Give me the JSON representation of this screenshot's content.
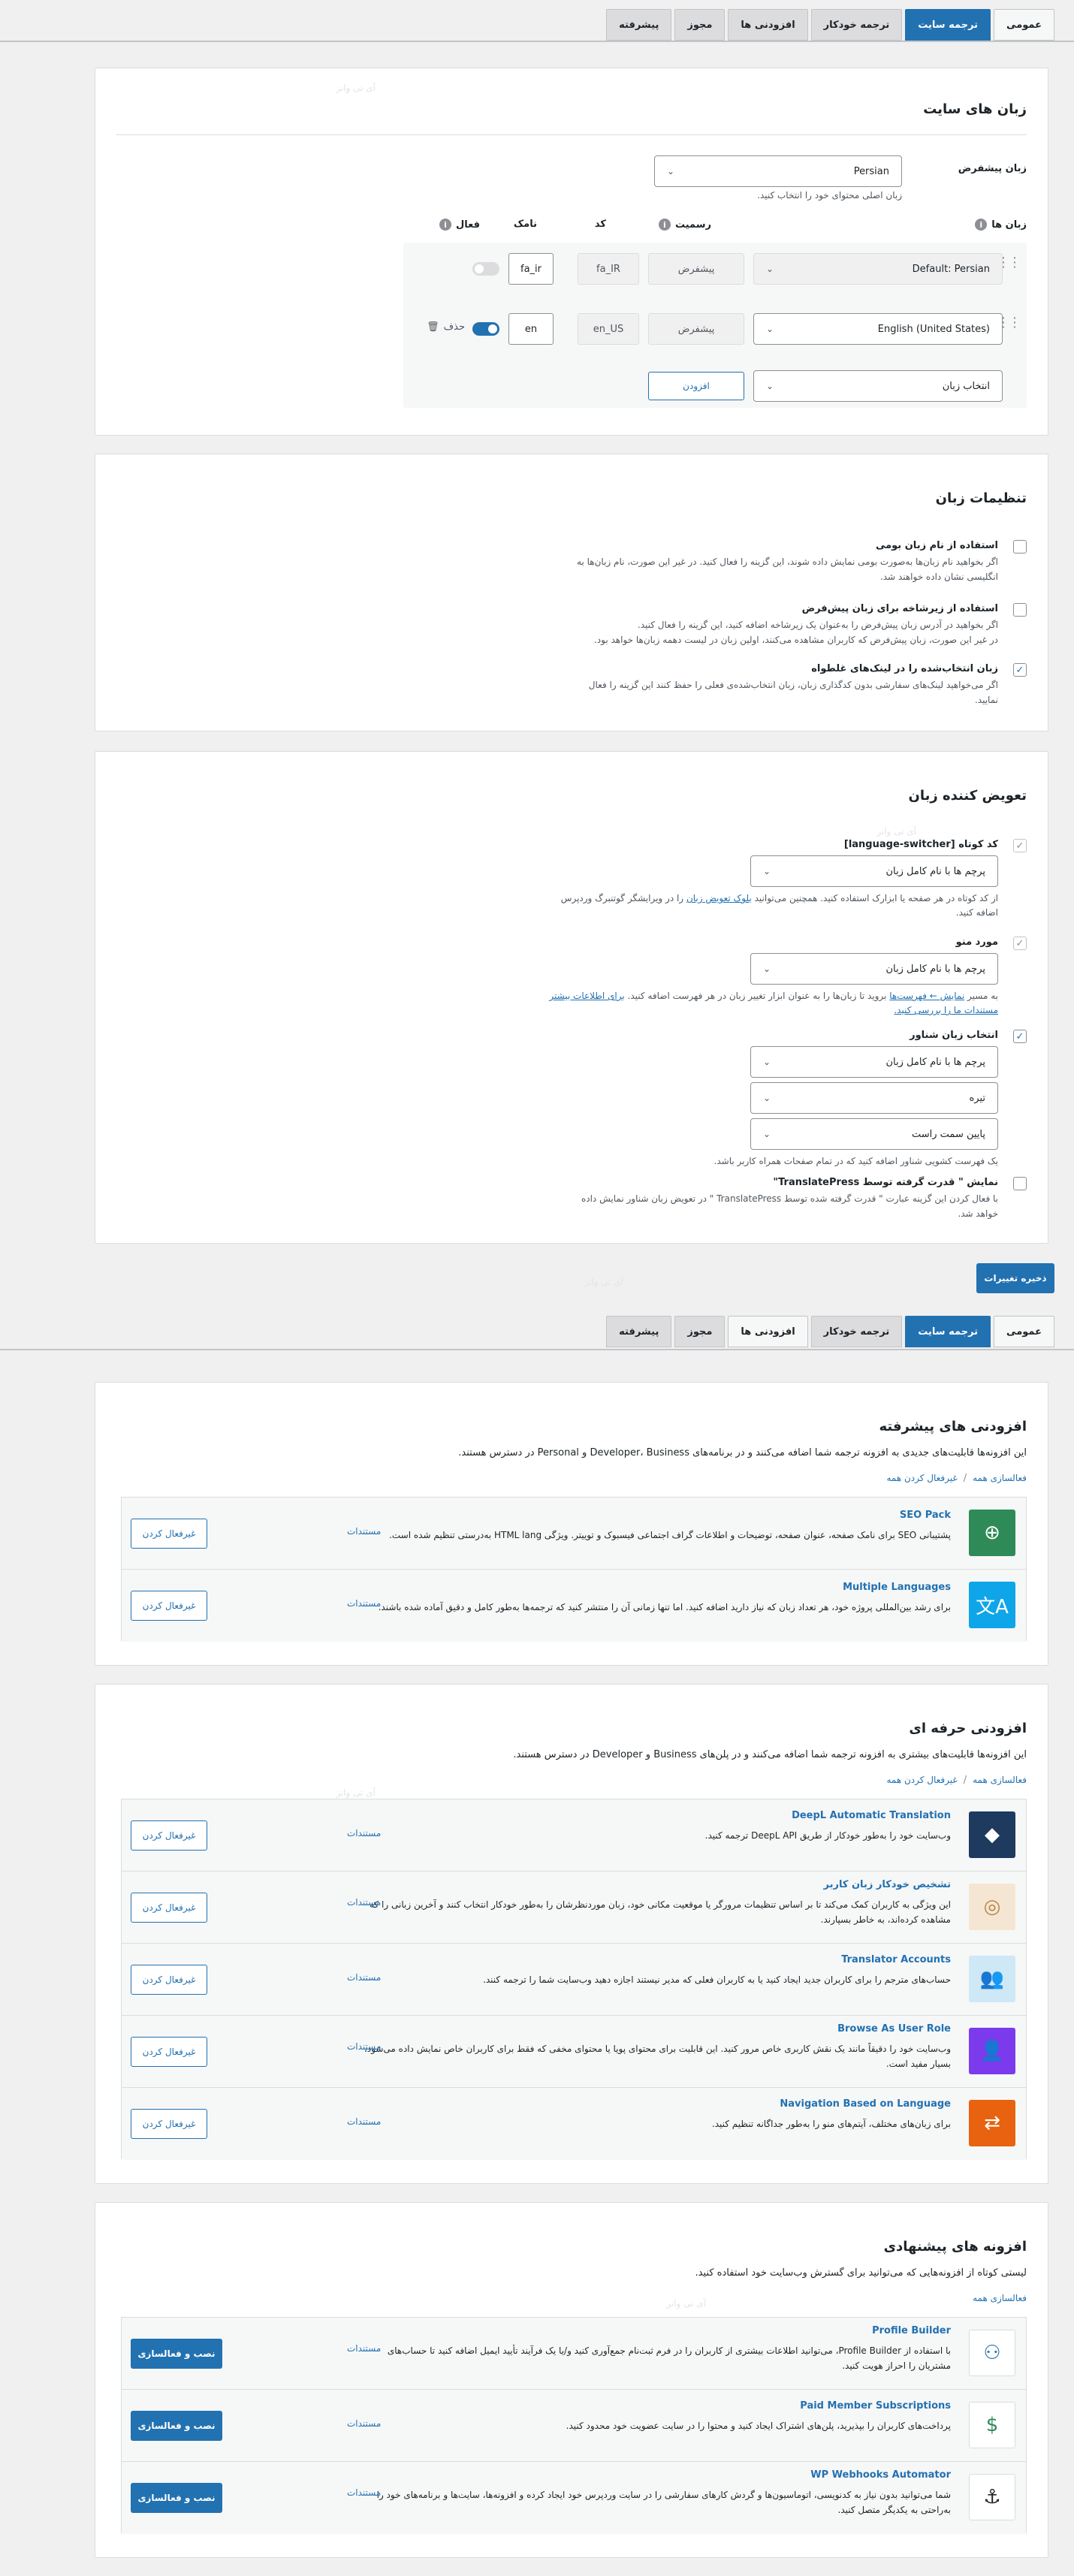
{
  "tabs": [
    "عمومی",
    "ترجمه سایت",
    "ترجمه خودکار",
    "افزودنی ها",
    "مجوز",
    "پیشرفته"
  ],
  "languages_card": {
    "title": "زبان های سایت",
    "default_label": "زبان پیشفرض",
    "default_value": "Persian",
    "default_hint": "زبان اصلی محتوای خود را انتخاب کنید.",
    "headers": {
      "languages": "زبان ها",
      "formal": "رسمیت",
      "code": "کد",
      "slug": "نامک",
      "active": "فعال"
    },
    "rows": [
      {
        "language": "Default: Persian",
        "formality": "پیشفرض",
        "code": "fa_IR",
        "slug": "fa_ir",
        "active": false
      },
      {
        "language": "English (United States)",
        "formality": "پیشفرض",
        "code": "en_US",
        "slug": "en",
        "active": true,
        "remove": "حذف"
      }
    ],
    "select_placeholder": "انتخاب زبان",
    "add_button": "افزودن"
  },
  "lang_settings": {
    "title": "تنظیمات زبان",
    "options": [
      {
        "label": "استفاده از نام زبان بومی",
        "checked": false,
        "desc1": "اگر بخواهید نام زبان‌ها به‌صورت بومی نمایش داده شوند، این گزینه را فعال کنید. در غیر این صورت، نام زبان‌ها به",
        "desc2": "انگلیسی نشان داده خواهند شد."
      },
      {
        "label": "استفاده از زیرشاخه برای زبان پیش‌فرض",
        "checked": false,
        "desc1": "اگر بخواهید در آدرس زبان پیش‌فرض را به‌عنوان یک زیرشاخه اضافه کنید، این گزینه را فعال کنید.",
        "desc2": "در غیر این صورت، زبان پیش‌فرض که کاربران مشاهده می‌کنند، اولین زبان در لیست دهمه زبان‌ها خواهد بود."
      },
      {
        "label": "زبان انتخاب‌شده را در لینک‌های غلطواه",
        "checked": true,
        "desc1": "اگر می‌خواهید لینک‌های سفارشی بدون کدگذاری زبان، زبان انتخاب‌شده‌ی فعلی را حفظ کنند این گزینه را فعال",
        "desc2": "نمایید."
      }
    ]
  },
  "switcher": {
    "title": "تعویض کننده زبان",
    "shortcode_label": "کد کوتاه [language-switcher]",
    "shortcode_value": "پرچم ها با نام کامل زبان",
    "shortcode_desc1": "از کد کوتاه در هر صفحه یا ابزارک استفاده کنید. همچنین می‌توانید",
    "shortcode_desc_link": "بلوک تعویض زبان",
    "shortcode_desc2": "را در ویرایشگر گوتنبرگ وردپرس",
    "shortcode_desc3": "اضافه کنید.",
    "menu_label": "مورد منو",
    "menu_value": "پرچم ها با نام کامل زبان",
    "menu_desc1": "به مسیر",
    "menu_desc_link1": "نمایش ← فهرست‌ها",
    "menu_desc2": "بروید تا زبان‌ها را به‌ عنوان ابزار تغییر زبان در هر فهرست اضافه کنید.",
    "menu_desc_link2": "برای اطلاعات بیشتر",
    "menu_desc_link3": "مستندات ما را بررسی کنید.",
    "floating_label": "انتخاب زبان شناور",
    "floating_value": "پرچم ها با نام کامل زبان",
    "floating_theme": "تیره",
    "floating_position": "پایین سمت راست",
    "floating_desc": "یک فهرست کشویی شناور اضافه کنید که در تمام صفحات همراه کاربر باشد.",
    "powered_label": "نمایش \" قدرت گرفته توسط TranslatePress\"",
    "powered_desc1": "با فعال کردن این گزینه عبارت \" قدرت گرفته شده توسط TranslatePress \" در تعویض زبان شناور نمایش داده",
    "powered_desc2": "خواهد شد."
  },
  "save_button": "ذخیره تغییرات",
  "adv_addons": {
    "title": "افزودنی های پیشرفته",
    "desc": "این افزونه‌ها قابلیت‌های جدیدی به افزونه ترجمه شما اضافه می‌کنند و در برنامه‌های Developer، Business و Personal در دسترس هستند.",
    "activate_all": "فعالسازی همه",
    "deactivate_all": "غیرفعال کردن همه",
    "items": [
      {
        "name": "SEO Pack",
        "desc": "پشتیبانی SEO برای نامک صفحه، عنوان صفحه، توضیحات و اطلاعات گراف اجتماعی فیسبوک و توییتر. ویژگی HTML lang به‌درستی تنظیم شده است.",
        "docs": "مستندات",
        "button": "غیرفعال کردن",
        "color": "#2e8b57",
        "icon": "globe-search-icon"
      },
      {
        "name": "Multiple Languages",
        "desc": "برای رشد بین‌المللی پروژه خود، هر تعداد زبان که نیاز دارید اضافه کنید. اما تنها زمانی آن را منتشر کنید که ترجمه‌ها به‌طور کامل و دقیق آماده شده باشند.",
        "docs": "مستندات",
        "button": "غیرفعال کردن",
        "color": "#0ea5e9",
        "icon": "translate-icon"
      }
    ]
  },
  "pro_addons": {
    "title": "افزودنی حرفه ای",
    "desc": "این افزونه‌ها قابلیت‌های بیشتری به افزونه ترجمه شما اضافه می‌کنند و در پلن‌های Business و Developer در دسترس هستند.",
    "activate_all": "فعالسازی همه",
    "deactivate_all": "غیرفعال کردن همه",
    "items": [
      {
        "name": "DeepL Automatic Translation",
        "desc1": "وب‌سایت خود را به‌طور خودکار از طریق DeepL API ترجمه کنید.",
        "desc2": "",
        "docs": "مستندات",
        "button": "غیرفعال کردن",
        "color": "#1e3a5f",
        "icon": "deepl-icon"
      },
      {
        "name": "تشخیص خودکار زبان کاربر",
        "desc1": "این ویژگی به کاربران کمک می‌کند تا بر اساس تنظیمات مرورگر یا موقعیت مکانی خود، زبان موردنظرشان را به‌طور خودکار انتخاب کنند و آخرین زبانی را که",
        "desc2": "مشاهده کرده‌اند، به خاطر بسپارند.",
        "docs": "مستندات",
        "button": "غیرفعال کردن",
        "color": "#f5e6d3",
        "icon": "target-icon"
      },
      {
        "name": "Translator Accounts",
        "desc1": "حساب‌های مترجم را برای کاربران جدید ایجاد کنید یا به کاربران فعلی که مدیر نیستند اجازه دهید وب‌سایت شما را ترجمه کنند.",
        "desc2": "",
        "docs": "مستندات",
        "button": "غیرفعال کردن",
        "color": "#cfe8f5",
        "icon": "users-icon"
      },
      {
        "name": "Browse As User Role",
        "desc1": "وب‌سایت خود را دقیقاً مانند یک نقش کاربری خاص مرور کنید. این قابلیت برای محتوای پویا یا محتوای مخفی که فقط برای کاربران خاص نمایش داده می‌شود،",
        "desc2": "بسیار مفید است.",
        "docs": "مستندات",
        "button": "غیرفعال کردن",
        "color": "#7c3aed",
        "icon": "user-role-icon"
      },
      {
        "name": "Navigation Based on Language",
        "desc1": "برای زبان‌های مختلف، آیتم‌های منو را به‌طور جداگانه تنظیم کنید.",
        "desc2": "",
        "docs": "مستندات",
        "button": "غیرفعال کردن",
        "color": "#e8620f",
        "icon": "swap-icon"
      }
    ]
  },
  "recommended": {
    "title": "افزونه های پیشنهادی",
    "desc": "لیستی کوتاه از افزونه‌هایی که می‌توانید برای گسترش وب‌سایت خود استفاده کنید.",
    "activate_all": "فعالسازی همه",
    "items": [
      {
        "name": "Profile Builder",
        "desc1": "با استفاده از Profile Builder، می‌توانید اطلاعات بیشتری از کاربران را در فرم ثبت‌نام جمع‌آوری کنید و/یا یک فرآیند تأیید ایمیل اضافه کنید تا حساب‌های",
        "desc2": "مشتریان را احراز هویت کنید.",
        "docs": "مستندات",
        "button": "نصب و فعالسازی",
        "color": "#ffffff",
        "icon": "profile-builder-icon"
      },
      {
        "name": "Paid Member Subscriptions",
        "desc1": "پرداخت‌های کاربران را بپذیرید، پلن‌های اشتراک ایجاد کنید و محتوا را در سایت عضویت خود محدود کنید.",
        "desc2": "",
        "docs": "مستندات",
        "button": "نصب و فعالسازی",
        "color": "#ffffff",
        "icon": "subscription-icon"
      },
      {
        "name": "WP Webhooks Automator",
        "desc1": "شما می‌توانید بدون نیاز به کدنویسی، اتوماسیون‌ها و گردش کارهای سفارشی را در سایت وردپرس خود ایجاد کرده و افزونه‌ها، سایت‌ها و برنامه‌های خود را",
        "desc2": "به‌راحتی به یکدیگر متصل کنید.",
        "docs": "مستندات",
        "button": "نصب و فعالسازی",
        "color": "#ffffff",
        "icon": "webhooks-icon"
      }
    ]
  },
  "watermark": "آی تی وانز"
}
